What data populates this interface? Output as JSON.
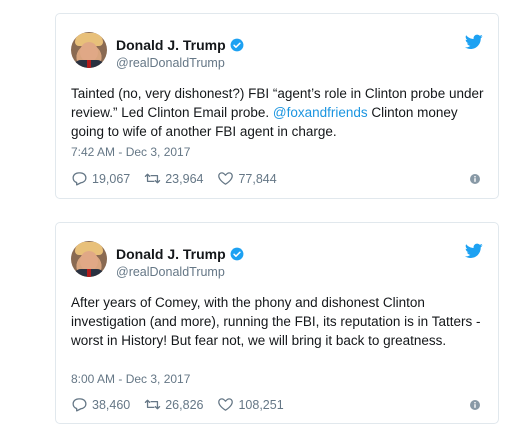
{
  "colors": {
    "link": "#1b95e0",
    "text": "#14171a",
    "muted": "#657786",
    "border": "#e1e8ed"
  },
  "tweets": [
    {
      "name": "Donald J. Trump",
      "handle": "@realDonaldTrump",
      "text_before": "Tainted (no, very dishonest?) FBI “agent’s role in Clinton probe under review.” Led Clinton Email probe. ",
      "mention": "@foxandfriends",
      "text_after": " Clinton money going to wife of another FBI agent in charge.",
      "timestamp": "7:42 AM - Dec 3, 2017",
      "replies": "19,067",
      "retweets": "23,964",
      "likes": "77,844"
    },
    {
      "name": "Donald J. Trump",
      "handle": "@realDonaldTrump",
      "text_before": "After years of Comey, with the phony and dishonest Clinton investigation (and more), running the FBI, its reputation is in Tatters - worst in History! But fear not, we will bring it back to greatness.",
      "mention": "",
      "text_after": "",
      "timestamp": "8:00 AM - Dec 3, 2017",
      "replies": "38,460",
      "retweets": "26,826",
      "likes": "108,251"
    }
  ],
  "icons": [
    "verified-badge-icon",
    "twitter-bird-icon",
    "reply-icon",
    "retweet-icon",
    "like-icon",
    "info-icon"
  ]
}
